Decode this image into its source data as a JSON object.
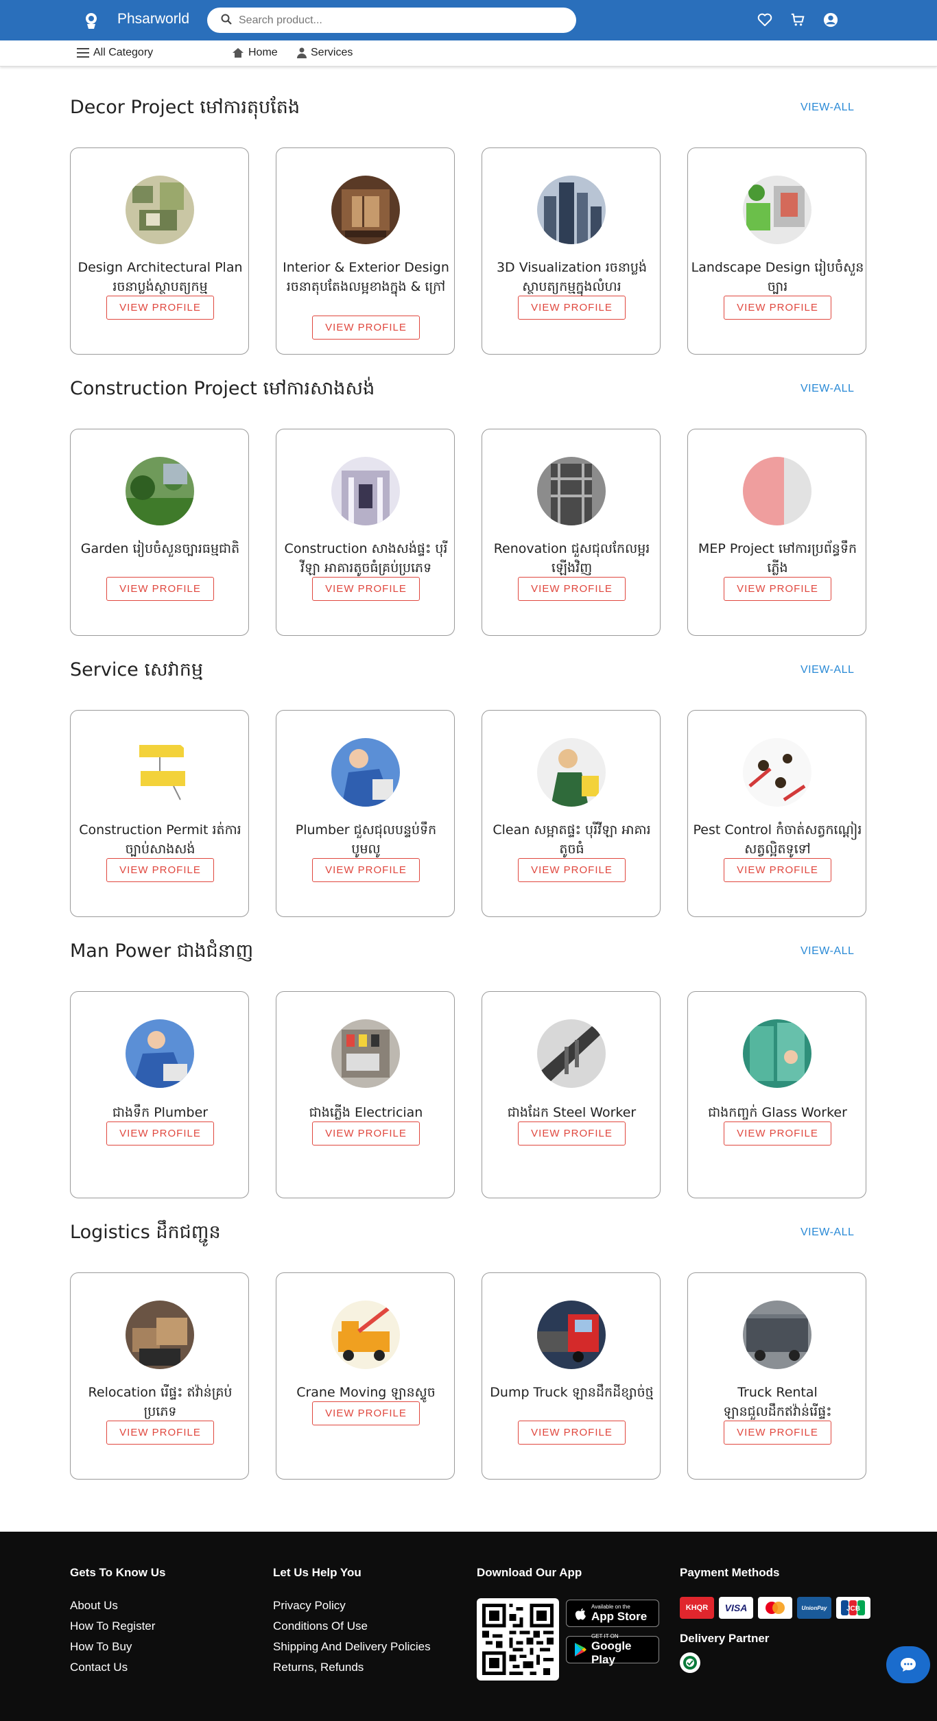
{
  "header": {
    "brand": "Phsarworld",
    "search_placeholder": "Search product...",
    "icons": [
      "heart-icon",
      "cart-icon",
      "account-icon"
    ],
    "colors": {
      "bar": "#2a6fbb"
    }
  },
  "subnav": {
    "all_category": "All Category",
    "home": "Home",
    "services": "Services"
  },
  "view_all_label": "VIEW-ALL",
  "view_profile_label": "VIEW PROFILE",
  "sections": [
    {
      "title": "Decor Project មៅការតុបតែង",
      "items": [
        {
          "title": "Design Architectural Plan រចនាប្លង់ស្ថាបត្យកម្ម"
        },
        {
          "title": "Interior & Exterior Design រចនាតុបតែងលម្អខាងក្នុង & ក្រៅ"
        },
        {
          "title": "3D Visualization រចនាប្លង់ស្ថាបត្យកម្មក្នុងលំហរ"
        },
        {
          "title": "Landscape Design រៀបចំសួនច្បារ"
        }
      ]
    },
    {
      "title": "Construction Project មៅការសាងសង់",
      "items": [
        {
          "title": "Garden រៀបចំសួនច្បារធម្មជាតិ"
        },
        {
          "title": "Construction សាងសង់ផ្ទះ បុរី វីឡា អាគារតូចធំគ្រប់ប្រភេទ"
        },
        {
          "title": "Renovation ជួសជុលកែលម្អរឡើងវិញ"
        },
        {
          "title": "MEP Project មៅការប្រព័ន្ធទឹកភ្លើង"
        }
      ]
    },
    {
      "title": "Service សេវាកម្ម",
      "items": [
        {
          "title": "Construction Permit រត់ការច្បាប់សាងសង់"
        },
        {
          "title": "Plumber ជួសជុលបន្ទប់ទឹក បូមលូ"
        },
        {
          "title": "Clean សម្អាតផ្ទះ បុរីវីឡា អាគារតូចធំ"
        },
        {
          "title": "Pest Control កំចាត់សត្វកណ្ដៀរ សត្វល្អិតទូទៅ"
        }
      ]
    },
    {
      "title": "Man Power ជាងជំនាញ",
      "items": [
        {
          "title": "ជាងទឹក Plumber"
        },
        {
          "title": "ជាងភ្លើង Electrician"
        },
        {
          "title": "ជាងដែក Steel Worker"
        },
        {
          "title": "ជាងកញ្ចក់ Glass Worker"
        }
      ]
    },
    {
      "title": "Logistics ដឹកជញ្ជូន",
      "items": [
        {
          "title": "Relocation រើផ្ទះ ឥវ៉ាន់គ្រប់ប្រភេទ"
        },
        {
          "title": "Crane Moving ឡានស្ទូច"
        },
        {
          "title": "Dump Truck ឡានដឹកដីខ្សាច់ថ្ម"
        },
        {
          "title": "Truck Rental ឡានជួលដឹកឥវ៉ាន់រើផ្ទះ"
        }
      ]
    }
  ],
  "footer": {
    "col1": {
      "heading": "Gets To Know Us",
      "links": [
        "About Us",
        "How To Register",
        "How To Buy",
        "Contact Us"
      ]
    },
    "col2": {
      "heading": "Let Us Help You",
      "links": [
        "Privacy Policy",
        "Conditions Of Use",
        "Shipping And Delivery Policies",
        "Returns, Refunds"
      ]
    },
    "col3": {
      "heading": "Download Our App",
      "appstore_small": "Available on the",
      "appstore_big": "App Store",
      "googleplay_small": "GET IT ON",
      "googleplay_big": "Google Play"
    },
    "col4": {
      "heading": "Payment Methods",
      "delivery_heading": "Delivery Partner",
      "methods": [
        "KHQR",
        "VISA",
        "Mastercard",
        "UnionPay",
        "JCB"
      ]
    }
  }
}
